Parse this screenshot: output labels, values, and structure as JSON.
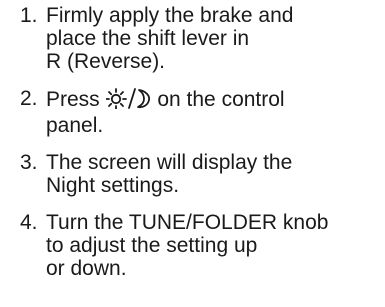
{
  "steps": [
    {
      "number": "1.",
      "lines": [
        "Firmly apply the brake and",
        "place the shift lever in",
        "R (Reverse)."
      ]
    },
    {
      "number": "2.",
      "before_icon": "Press ",
      "icon": "day-night-icon",
      "after_icon": " on the control",
      "line2": "panel."
    },
    {
      "number": "3.",
      "lines": [
        "The screen will display the",
        "Night settings."
      ]
    },
    {
      "number": "4.",
      "lines": [
        "Turn the TUNE/FOLDER knob",
        "to adjust the setting up",
        "or down."
      ]
    }
  ]
}
